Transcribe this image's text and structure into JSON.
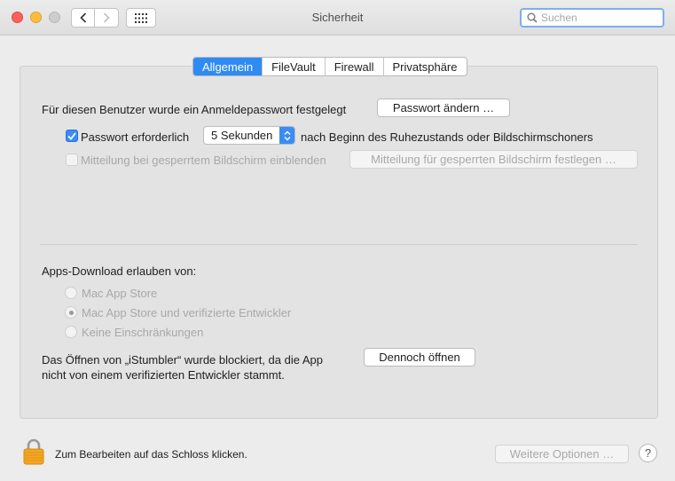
{
  "window": {
    "title": "Sicherheit",
    "search_placeholder": "Suchen"
  },
  "tabs": [
    {
      "label": "Allgemein",
      "active": true
    },
    {
      "label": "FileVault",
      "active": false
    },
    {
      "label": "Firewall",
      "active": false
    },
    {
      "label": "Privatsphäre",
      "active": false
    }
  ],
  "general": {
    "password_set_text": "Für diesen Benutzer wurde ein Anmeldepasswort festgelegt",
    "change_password_button": "Passwort ändern …",
    "require_password": {
      "checked": true,
      "label": "Passwort erforderlich",
      "delay_value": "5 Sekunden",
      "suffix": "nach Beginn des Ruhezustands oder Bildschirmschoners"
    },
    "lock_message": {
      "checked": false,
      "label": "Mitteilung bei gesperrtem Bildschirm einblenden",
      "button": "Mitteilung für gesperrten Bildschirm festlegen …"
    }
  },
  "downloads": {
    "heading": "Apps-Download erlauben von:",
    "options": [
      {
        "label": "Mac App Store",
        "selected": false
      },
      {
        "label": "Mac App Store und verifizierte Entwickler",
        "selected": true
      },
      {
        "label": "Keine Einschränkungen",
        "selected": false
      }
    ],
    "blocked_line1": "Das Öffnen von „iStumbler“ wurde blockiert, da die App",
    "blocked_line2": "nicht von einem verifizierten Entwickler stammt.",
    "open_anyway_button": "Dennoch öffnen"
  },
  "footer": {
    "lock_text": "Zum Bearbeiten auf das Schloss klicken.",
    "advanced_button": "Weitere Optionen …",
    "help_label": "?"
  },
  "colors": {
    "accent": "#2f8bf4",
    "close": "#fc605c",
    "minimize": "#fdbc40",
    "lock": "#f5a623"
  }
}
